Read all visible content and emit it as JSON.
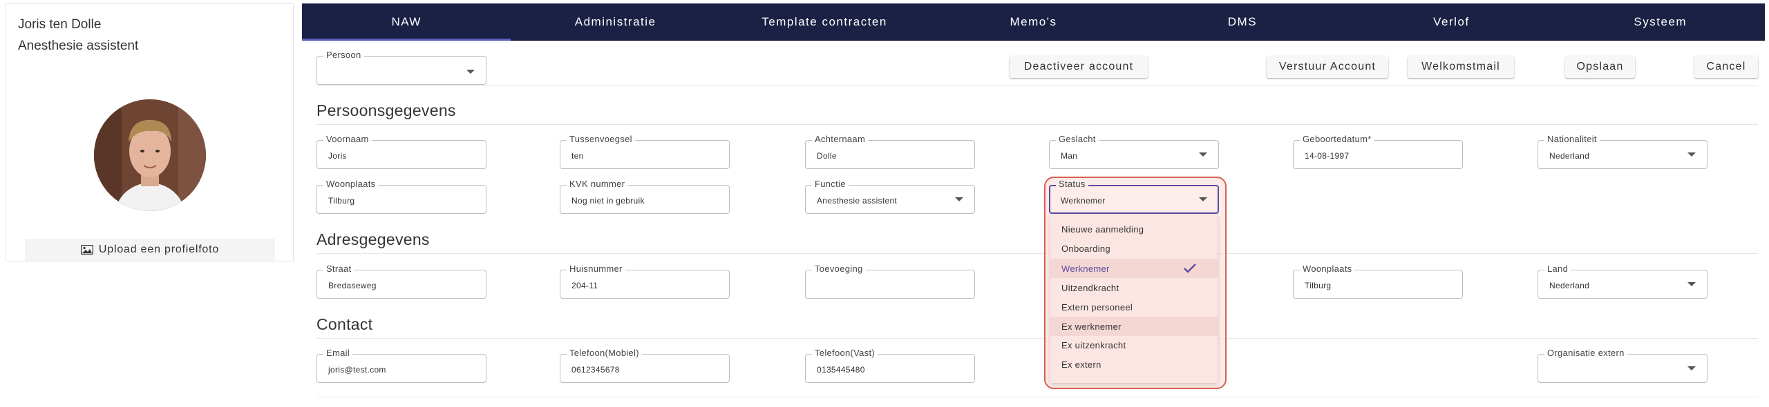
{
  "profile": {
    "name": "Joris ten Dolle",
    "role": "Anesthesie assistent",
    "upload_label": "Upload een profielfoto"
  },
  "nav": {
    "tabs": [
      "NAW",
      "Administratie",
      "Template contracten",
      "Memo's",
      "DMS",
      "Verlof",
      "Systeem"
    ],
    "active": "NAW"
  },
  "toolbar": {
    "persoon_label": "Persoon",
    "persoon_value": "",
    "deactivate": "Deactiveer account",
    "send_account": "Verstuur Account",
    "welcome_mail": "Welkomstmail",
    "save": "Opslaan",
    "cancel": "Cancel"
  },
  "sections": {
    "persoonsgegevens": "Persoonsgegevens",
    "adresgegevens": "Adresgegevens",
    "contact": "Contact"
  },
  "persoon": {
    "voornaam": {
      "label": "Voornaam",
      "value": "Joris"
    },
    "tussenvoegsel": {
      "label": "Tussenvoegsel",
      "value": "ten"
    },
    "achternaam": {
      "label": "Achternaam",
      "value": "Dolle"
    },
    "geslacht": {
      "label": "Geslacht",
      "value": "Man"
    },
    "geboortedatum": {
      "label": "Geboortedatum*",
      "value": "14-08-1997"
    },
    "nationaliteit": {
      "label": "Nationaliteit",
      "value": "Nederland"
    },
    "woonplaats": {
      "label": "Woonplaats",
      "value": "Tilburg"
    },
    "kvk": {
      "label": "KVK nummer",
      "value": "Nog niet in gebruik"
    },
    "functie": {
      "label": "Functie",
      "value": "Anesthesie assistent"
    },
    "status": {
      "label": "Status",
      "value": "Werknemer"
    }
  },
  "status_options": [
    "Nieuwe aanmelding",
    "Onboarding",
    "Werknemer",
    "Uitzendkracht",
    "Extern personeel",
    "Ex werknemer",
    "Ex uitzenkracht",
    "Ex extern"
  ],
  "status_selected": "Werknemer",
  "adres": {
    "straat": {
      "label": "Straat",
      "value": "Bredaseweg"
    },
    "huisnummer": {
      "label": "Huisnummer",
      "value": "204-11"
    },
    "toevoeging": {
      "label": "Toevoeging",
      "value": ""
    },
    "woonplaats": {
      "label": "Woonplaats",
      "value": "Tilburg"
    },
    "land": {
      "label": "Land",
      "value": "Nederland"
    }
  },
  "contact": {
    "email": {
      "label": "Email",
      "value": "joris@test.com"
    },
    "mobiel": {
      "label": "Telefoon(Mobiel)",
      "value": "0612345678"
    },
    "vast": {
      "label": "Telefoon(Vast)",
      "value": "0135445480"
    },
    "organisatie": {
      "label": "Organisatie extern",
      "value": ""
    }
  },
  "colors": {
    "nav_bg": "#1b2045",
    "accent": "#5b4a9e",
    "highlight_border": "#d8604f",
    "highlight_fill": "#f9dbd6"
  }
}
